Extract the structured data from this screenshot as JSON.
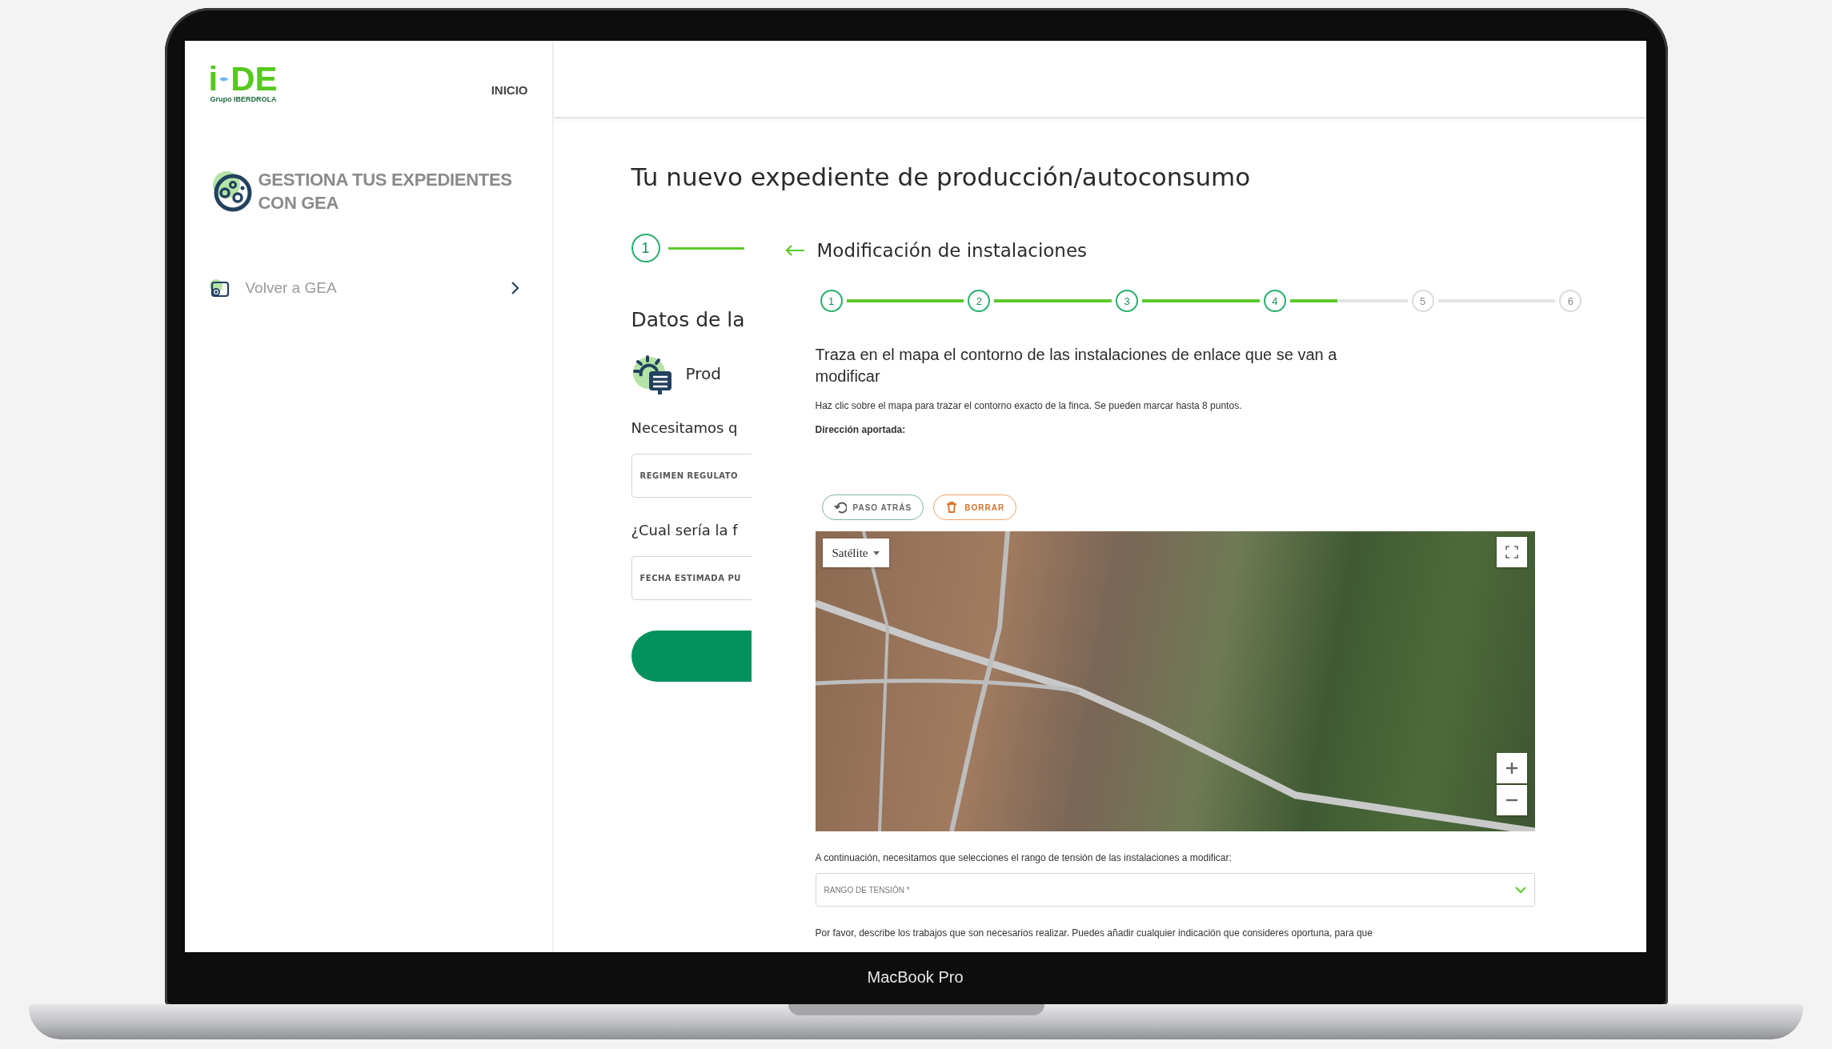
{
  "device": {
    "label": "MacBook Pro"
  },
  "sidebar": {
    "logo": {
      "letter": "i",
      "letters": "DE",
      "group": "Grupo IBERDROLA"
    },
    "nav_link": "INICIO",
    "section_title": "GESTIONA TUS EXPEDIENTES CON GEA",
    "items": [
      {
        "label": "Volver a GEA"
      }
    ]
  },
  "main": {
    "title": "Tu nuevo expediente de producción/autoconsumo",
    "form": {
      "step_number": "1",
      "section_title": "Datos de la",
      "product": "Prod",
      "question_1": "Necesitamos q",
      "field_1": {
        "placeholder": "REGIMEN REGULATO"
      },
      "question_2": "¿Cual sería la f",
      "field_2": {
        "placeholder": "FECHA ESTIMADA PU"
      }
    },
    "panel": {
      "title": "Modificación de instalaciones",
      "steps": [
        {
          "number": "1",
          "completed": true
        },
        {
          "number": "2",
          "completed": true
        },
        {
          "number": "3",
          "completed": true
        },
        {
          "number": "4",
          "completed": true
        },
        {
          "number": "5",
          "completed": false
        },
        {
          "number": "6",
          "completed": false
        }
      ],
      "connectors": [
        {
          "level": 1
        },
        {
          "level": 1
        },
        {
          "level": 1
        },
        {
          "level": 0.4
        },
        {
          "level": 0
        }
      ],
      "heading": "Traza en el mapa el contorno de las instalaciones de enlace que se van a modificar",
      "hint": "Haz clic sobre el mapa para trazar el contorno exacto de la finca. Se pueden marcar hasta 8 puntos.",
      "address_label": "Dirección aportada:",
      "tools": [
        {
          "label": "PASO ATRÁS",
          "kind": "undo"
        },
        {
          "label": "BORRAR",
          "kind": "delete"
        }
      ],
      "map": {
        "map_type": "Satélite"
      },
      "voltage_prompt": "A continuación, necesitamos que selecciones el rango de tensión de las instalaciones a modificar:",
      "voltage_select": {
        "placeholder": "RANGO DE TENSIÓN *"
      },
      "description_prompt": "Por favor, describe los trabajos que son necesarios realizar. Puedes añadir cualquier indicación que consideres oportuna, para que"
    }
  }
}
